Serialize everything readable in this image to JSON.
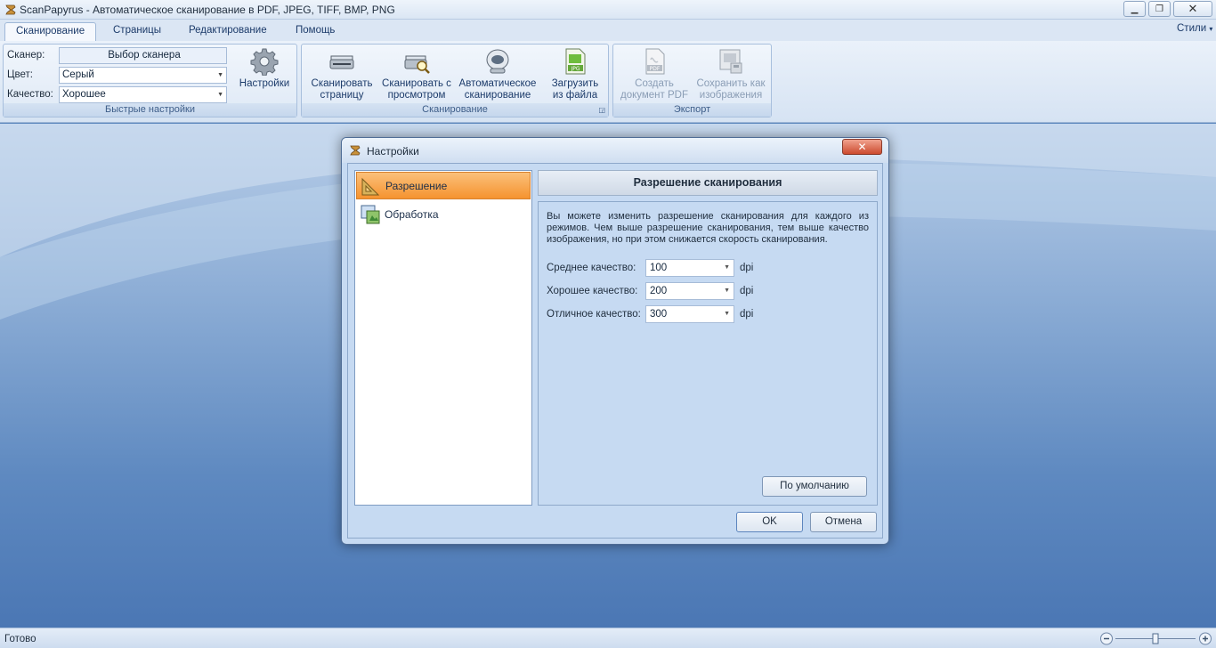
{
  "window": {
    "title": "ScanPapyrus - Автоматическое сканирование в PDF, JPEG, TIFF, BMP, PNG",
    "minimize": "▁",
    "maximize": "❐",
    "close": "✕"
  },
  "ribbon_tabs": [
    "Сканирование",
    "Страницы",
    "Редактирование",
    "Помощь"
  ],
  "styles_menu": "Стили",
  "quick_settings": {
    "scanner_label": "Сканер:",
    "scanner_value": "Выбор сканера",
    "color_label": "Цвет:",
    "color_value": "Серый",
    "quality_label": "Качество:",
    "quality_value": "Хорошее",
    "settings_button": "Настройки",
    "group_label": "Быстрые настройки"
  },
  "scanning_group": {
    "buttons": [
      {
        "line1": "Сканировать",
        "line2": "страницу",
        "icon": "scanner-icon"
      },
      {
        "line1": "Сканировать с",
        "line2": "просмотром",
        "icon": "scanner-preview-icon"
      },
      {
        "line1": "Автоматическое",
        "line2": "сканирование",
        "icon": "auto-scan-icon"
      },
      {
        "line1": "Загрузить",
        "line2": "из файла",
        "icon": "jpg-file-icon"
      }
    ],
    "group_label": "Сканирование"
  },
  "export_group": {
    "buttons": [
      {
        "line1": "Создать",
        "line2": "документ PDF",
        "icon": "pdf-file-icon"
      },
      {
        "line1": "Сохранить как",
        "line2": "изображения",
        "icon": "save-images-icon"
      }
    ],
    "group_label": "Экспорт"
  },
  "dialog": {
    "title": "Настройки",
    "nav": [
      {
        "label": "Разрешение",
        "selected": true,
        "icon": "ruler-triangle-icon"
      },
      {
        "label": "Обработка",
        "selected": false,
        "icon": "image-processing-icon"
      }
    ],
    "panel_title": "Разрешение сканирования",
    "description": "Вы можете изменить разрешение сканирования для каждого из режимов. Чем выше разрешение сканирования, тем выше качество изображения, но при этом снижается скорость сканирования.",
    "qualities": [
      {
        "label": "Среднее качество:",
        "value": "100",
        "unit": "dpi"
      },
      {
        "label": "Хорошее качество:",
        "value": "200",
        "unit": "dpi"
      },
      {
        "label": "Отличное качество:",
        "value": "300",
        "unit": "dpi"
      }
    ],
    "default_button": "По умолчанию",
    "ok_button": "OK",
    "cancel_button": "Отмена"
  },
  "status": {
    "text": "Готово"
  },
  "colors": {
    "accent_orange": "#f5932f",
    "ribbon_blue": "#dbe6f4",
    "workspace_blue": "#5e89c0"
  }
}
